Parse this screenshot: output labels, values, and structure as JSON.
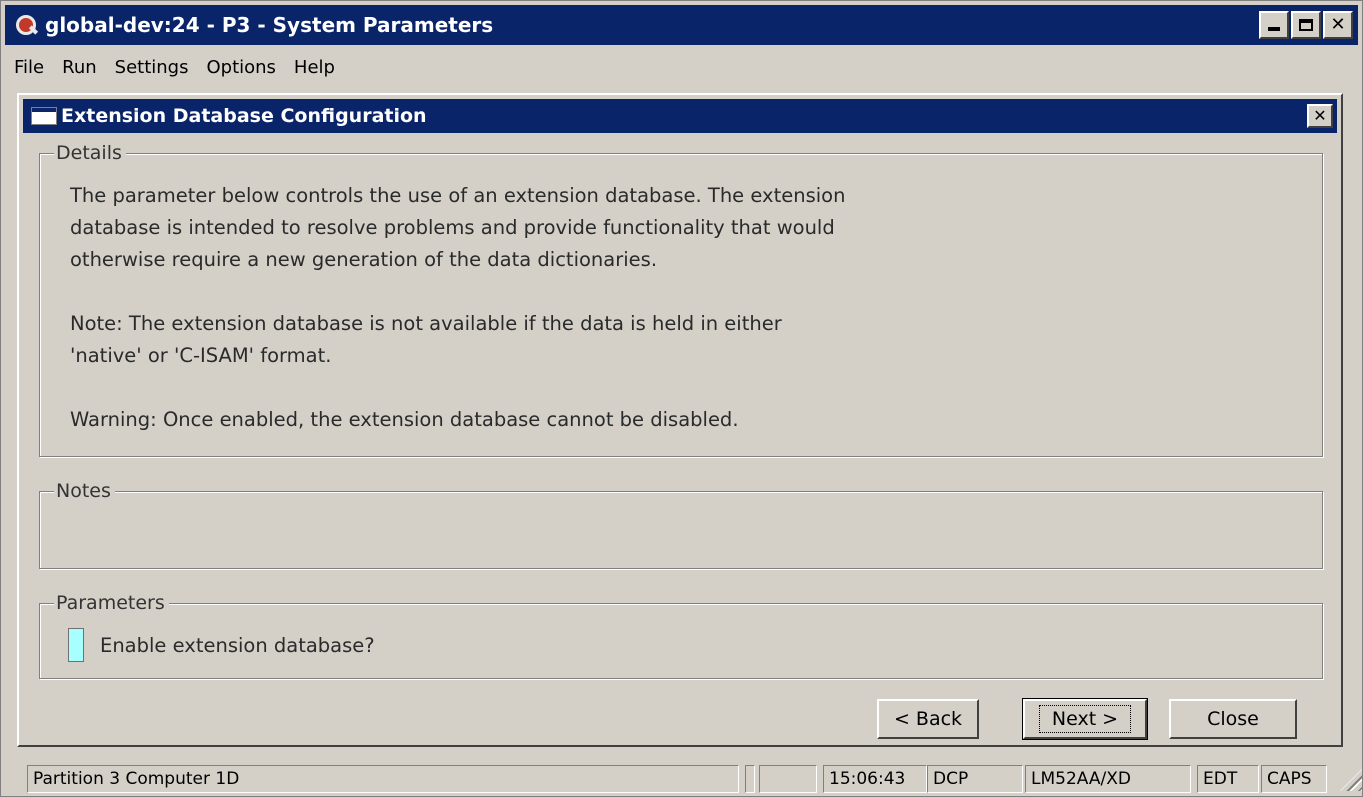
{
  "window": {
    "title": "global-dev:24 - P3 - System Parameters",
    "icon": "magnifier-app-icon",
    "controls": [
      "minimize",
      "maximize",
      "close"
    ]
  },
  "menu": {
    "items": [
      "File",
      "Run",
      "Settings",
      "Options",
      "Help"
    ]
  },
  "dialog": {
    "title": "Extension Database Configuration",
    "details": {
      "legend": "Details",
      "lines": [
        "The parameter below controls the use of an extension database. The extension",
        "database is intended to resolve problems and provide functionality that would",
        "otherwise require a new generation of the data dictionaries.",
        "Note: The extension database is not available if the data is held in either",
        "'native' or 'C-ISAM' format.",
        "Warning: Once enabled, the extension database cannot be disabled."
      ]
    },
    "notes": {
      "legend": "Notes"
    },
    "parameters": {
      "legend": "Parameters",
      "enable_label": "Enable extension database?",
      "enable_value": false
    },
    "buttons": {
      "back": "< Back",
      "next": "Next >",
      "close": "Close"
    }
  },
  "statusbar": {
    "message": "Partition 3 Computer 1D",
    "time": "15:06:43",
    "mode": "DCP",
    "terminal": "LM52AA/XD",
    "edit": "EDT",
    "caps": "CAPS"
  },
  "colors": {
    "titlebar": "#0a246a",
    "face": "#d4d0c8",
    "field_highlight": "#a8ffff"
  }
}
